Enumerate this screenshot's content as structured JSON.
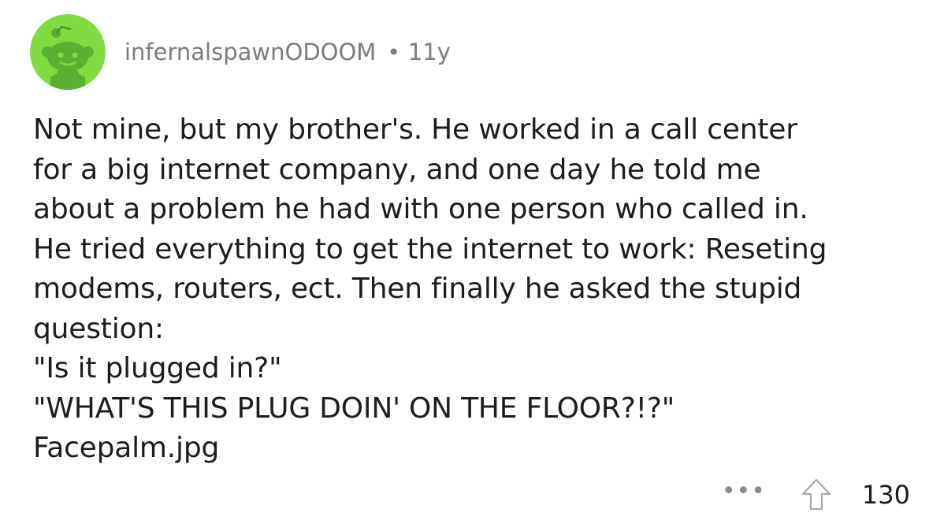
{
  "comment": {
    "author": "infernalspawnODOOM",
    "separator": "•",
    "age": "11y",
    "avatar_icon": "reddit-snoo-avatar-icon",
    "avatar_bg": "#7fdb3f",
    "avatar_fg": "#4fa52a",
    "body_lines": [
      "Not mine, but my brother's. He worked in a call center",
      "for a big internet company, and one day he told me",
      "about a problem he had with one person who called in.",
      "He tried everything to get the internet to work: Reseting",
      "modems, routers, ect. Then finally he asked the stupid",
      "question:",
      "\"Is it plugged in?\"",
      "\"WHAT'S THIS PLUG DOIN' ON THE FLOOR?!?\"",
      "Facepalm.jpg"
    ],
    "more_label": "•••",
    "upvote_icon": "upvote-arrow-icon",
    "score": "130"
  }
}
